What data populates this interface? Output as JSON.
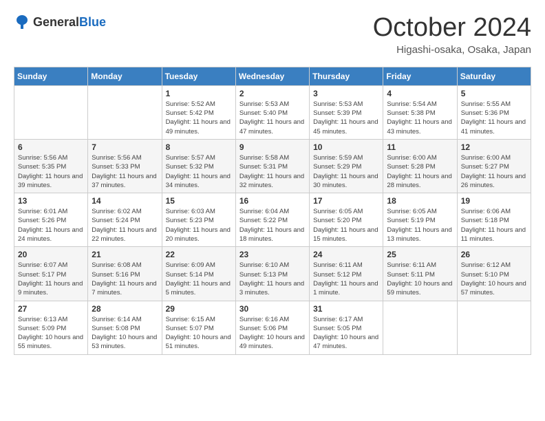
{
  "header": {
    "logo_general": "General",
    "logo_blue": "Blue",
    "month_title": "October 2024",
    "location": "Higashi-osaka, Osaka, Japan"
  },
  "weekdays": [
    "Sunday",
    "Monday",
    "Tuesday",
    "Wednesday",
    "Thursday",
    "Friday",
    "Saturday"
  ],
  "weeks": [
    [
      {
        "day": "",
        "info": ""
      },
      {
        "day": "",
        "info": ""
      },
      {
        "day": "1",
        "info": "Sunrise: 5:52 AM\nSunset: 5:42 PM\nDaylight: 11 hours and 49 minutes."
      },
      {
        "day": "2",
        "info": "Sunrise: 5:53 AM\nSunset: 5:40 PM\nDaylight: 11 hours and 47 minutes."
      },
      {
        "day": "3",
        "info": "Sunrise: 5:53 AM\nSunset: 5:39 PM\nDaylight: 11 hours and 45 minutes."
      },
      {
        "day": "4",
        "info": "Sunrise: 5:54 AM\nSunset: 5:38 PM\nDaylight: 11 hours and 43 minutes."
      },
      {
        "day": "5",
        "info": "Sunrise: 5:55 AM\nSunset: 5:36 PM\nDaylight: 11 hours and 41 minutes."
      }
    ],
    [
      {
        "day": "6",
        "info": "Sunrise: 5:56 AM\nSunset: 5:35 PM\nDaylight: 11 hours and 39 minutes."
      },
      {
        "day": "7",
        "info": "Sunrise: 5:56 AM\nSunset: 5:33 PM\nDaylight: 11 hours and 37 minutes."
      },
      {
        "day": "8",
        "info": "Sunrise: 5:57 AM\nSunset: 5:32 PM\nDaylight: 11 hours and 34 minutes."
      },
      {
        "day": "9",
        "info": "Sunrise: 5:58 AM\nSunset: 5:31 PM\nDaylight: 11 hours and 32 minutes."
      },
      {
        "day": "10",
        "info": "Sunrise: 5:59 AM\nSunset: 5:29 PM\nDaylight: 11 hours and 30 minutes."
      },
      {
        "day": "11",
        "info": "Sunrise: 6:00 AM\nSunset: 5:28 PM\nDaylight: 11 hours and 28 minutes."
      },
      {
        "day": "12",
        "info": "Sunrise: 6:00 AM\nSunset: 5:27 PM\nDaylight: 11 hours and 26 minutes."
      }
    ],
    [
      {
        "day": "13",
        "info": "Sunrise: 6:01 AM\nSunset: 5:26 PM\nDaylight: 11 hours and 24 minutes."
      },
      {
        "day": "14",
        "info": "Sunrise: 6:02 AM\nSunset: 5:24 PM\nDaylight: 11 hours and 22 minutes."
      },
      {
        "day": "15",
        "info": "Sunrise: 6:03 AM\nSunset: 5:23 PM\nDaylight: 11 hours and 20 minutes."
      },
      {
        "day": "16",
        "info": "Sunrise: 6:04 AM\nSunset: 5:22 PM\nDaylight: 11 hours and 18 minutes."
      },
      {
        "day": "17",
        "info": "Sunrise: 6:05 AM\nSunset: 5:20 PM\nDaylight: 11 hours and 15 minutes."
      },
      {
        "day": "18",
        "info": "Sunrise: 6:05 AM\nSunset: 5:19 PM\nDaylight: 11 hours and 13 minutes."
      },
      {
        "day": "19",
        "info": "Sunrise: 6:06 AM\nSunset: 5:18 PM\nDaylight: 11 hours and 11 minutes."
      }
    ],
    [
      {
        "day": "20",
        "info": "Sunrise: 6:07 AM\nSunset: 5:17 PM\nDaylight: 11 hours and 9 minutes."
      },
      {
        "day": "21",
        "info": "Sunrise: 6:08 AM\nSunset: 5:16 PM\nDaylight: 11 hours and 7 minutes."
      },
      {
        "day": "22",
        "info": "Sunrise: 6:09 AM\nSunset: 5:14 PM\nDaylight: 11 hours and 5 minutes."
      },
      {
        "day": "23",
        "info": "Sunrise: 6:10 AM\nSunset: 5:13 PM\nDaylight: 11 hours and 3 minutes."
      },
      {
        "day": "24",
        "info": "Sunrise: 6:11 AM\nSunset: 5:12 PM\nDaylight: 11 hours and 1 minute."
      },
      {
        "day": "25",
        "info": "Sunrise: 6:11 AM\nSunset: 5:11 PM\nDaylight: 10 hours and 59 minutes."
      },
      {
        "day": "26",
        "info": "Sunrise: 6:12 AM\nSunset: 5:10 PM\nDaylight: 10 hours and 57 minutes."
      }
    ],
    [
      {
        "day": "27",
        "info": "Sunrise: 6:13 AM\nSunset: 5:09 PM\nDaylight: 10 hours and 55 minutes."
      },
      {
        "day": "28",
        "info": "Sunrise: 6:14 AM\nSunset: 5:08 PM\nDaylight: 10 hours and 53 minutes."
      },
      {
        "day": "29",
        "info": "Sunrise: 6:15 AM\nSunset: 5:07 PM\nDaylight: 10 hours and 51 minutes."
      },
      {
        "day": "30",
        "info": "Sunrise: 6:16 AM\nSunset: 5:06 PM\nDaylight: 10 hours and 49 minutes."
      },
      {
        "day": "31",
        "info": "Sunrise: 6:17 AM\nSunset: 5:05 PM\nDaylight: 10 hours and 47 minutes."
      },
      {
        "day": "",
        "info": ""
      },
      {
        "day": "",
        "info": ""
      }
    ]
  ]
}
